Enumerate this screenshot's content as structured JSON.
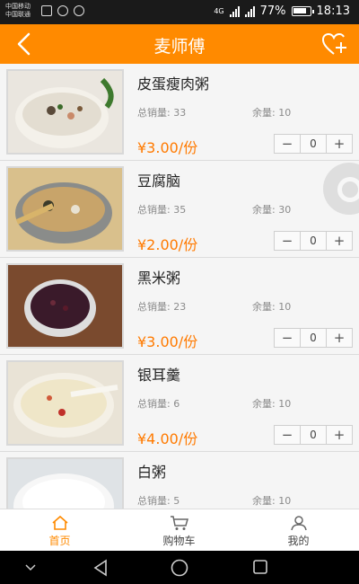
{
  "status_bar": {
    "carrier1": "中国移动",
    "carrier2": "中国联通",
    "network": "4G",
    "battery": "77%",
    "time": "18:13"
  },
  "header": {
    "title": "麦师傅",
    "back_icon": "back-arrow-icon",
    "fav_icon": "heart-plus-icon"
  },
  "labels": {
    "sold": "总销量:",
    "remaining": "余量:",
    "price_suffix": "/份"
  },
  "products": [
    {
      "name": "皮蛋瘦肉粥",
      "sold": "总销量: 33",
      "remaining": "余量: 10",
      "price": "¥3.00/份",
      "qty": "0",
      "minus": "−",
      "plus": "+"
    },
    {
      "name": "豆腐脑",
      "sold": "总销量: 35",
      "remaining": "余量: 30",
      "price": "¥2.00/份",
      "qty": "0",
      "minus": "−",
      "plus": "+"
    },
    {
      "name": "黑米粥",
      "sold": "总销量: 23",
      "remaining": "余量: 10",
      "price": "¥3.00/份",
      "qty": "0",
      "minus": "−",
      "plus": "+"
    },
    {
      "name": "银耳羹",
      "sold": "总销量: 6",
      "remaining": "余量: 10",
      "price": "¥4.00/份",
      "qty": "0",
      "minus": "−",
      "plus": "+"
    },
    {
      "name": "白粥",
      "sold": "总销量: 5",
      "remaining": "余量: 10",
      "price": "",
      "qty": "",
      "minus": "",
      "plus": ""
    }
  ],
  "tabs": [
    {
      "label": "首页",
      "icon": "home-icon",
      "active": true
    },
    {
      "label": "购物车",
      "icon": "cart-icon",
      "active": false
    },
    {
      "label": "我的",
      "icon": "person-icon",
      "active": false
    }
  ],
  "colors": {
    "accent": "#ff8a00",
    "price": "#ff7a00"
  }
}
